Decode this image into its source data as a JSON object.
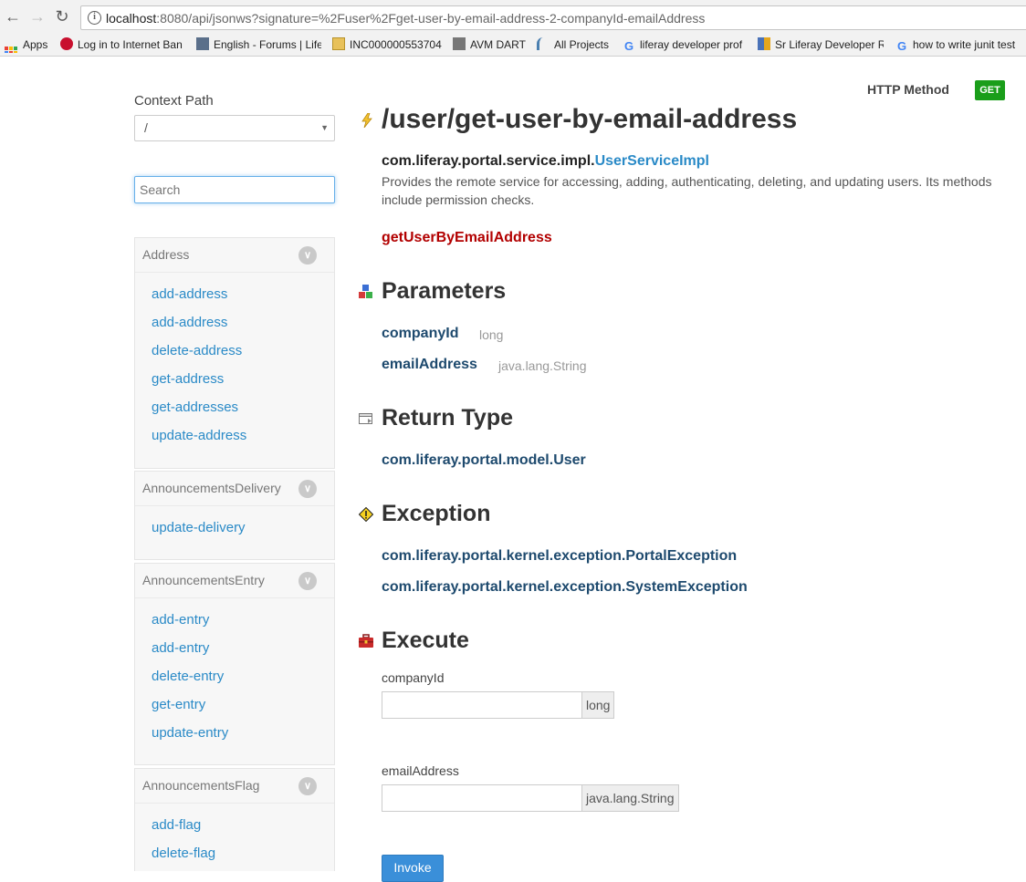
{
  "browser": {
    "url_host": "localhost",
    "url_rest": ":8080/api/jsonws?signature=%2Fuser%2Fget-user-by-email-address-2-companyId-emailAddress",
    "bookmarks": [
      {
        "label": "Apps"
      },
      {
        "label": "Log in to Internet Ban"
      },
      {
        "label": "English - Forums | Life"
      },
      {
        "label": "INC000000553704"
      },
      {
        "label": "AVM DART"
      },
      {
        "label": "All Projects"
      },
      {
        "label": "liferay developer prof"
      },
      {
        "label": "Sr Liferay Developer R"
      },
      {
        "label": "how to write junit test"
      }
    ]
  },
  "sidebar": {
    "context_label": "Context Path",
    "context_value": "/",
    "search_placeholder": "Search",
    "panels": [
      {
        "title": "Address",
        "items": [
          "add-address",
          "add-address",
          "delete-address",
          "get-address",
          "get-addresses",
          "update-address"
        ]
      },
      {
        "title": "AnnouncementsDelivery",
        "items": [
          "update-delivery"
        ]
      },
      {
        "title": "AnnouncementsEntry",
        "items": [
          "add-entry",
          "add-entry",
          "delete-entry",
          "get-entry",
          "update-entry"
        ]
      },
      {
        "title": "AnnouncementsFlag",
        "items": [
          "add-flag",
          "delete-flag"
        ]
      }
    ]
  },
  "main": {
    "http_method_label": "HTTP Method",
    "http_method": "GET",
    "title": "/user/get-user-by-email-address",
    "class_prefix": "com.liferay.portal.service.impl.",
    "class_link": "UserServiceImpl",
    "description": "Provides the remote service for accessing, adding, authenticating, deleting, and updating users. Its methods include permission checks.",
    "method_name": "getUserByEmailAddress",
    "parameters_title": "Parameters",
    "parameters": [
      {
        "name": "companyId",
        "type": "long"
      },
      {
        "name": "emailAddress",
        "type": "java.lang.String"
      }
    ],
    "return_title": "Return Type",
    "return_type": "com.liferay.portal.model.User",
    "exception_title": "Exception",
    "exceptions": [
      "com.liferay.portal.kernel.exception.PortalException",
      "com.liferay.portal.kernel.exception.SystemException"
    ],
    "execute_title": "Execute",
    "execute_fields": [
      {
        "label": "companyId",
        "type": "long"
      },
      {
        "label": "emailAddress",
        "type": "java.lang.String"
      }
    ],
    "invoke_label": "Invoke"
  },
  "colors": {
    "link": "#2a8ac7",
    "method": "#b20000",
    "get_badge": "#1a9e1a",
    "param_name": "#1e4a6e"
  }
}
